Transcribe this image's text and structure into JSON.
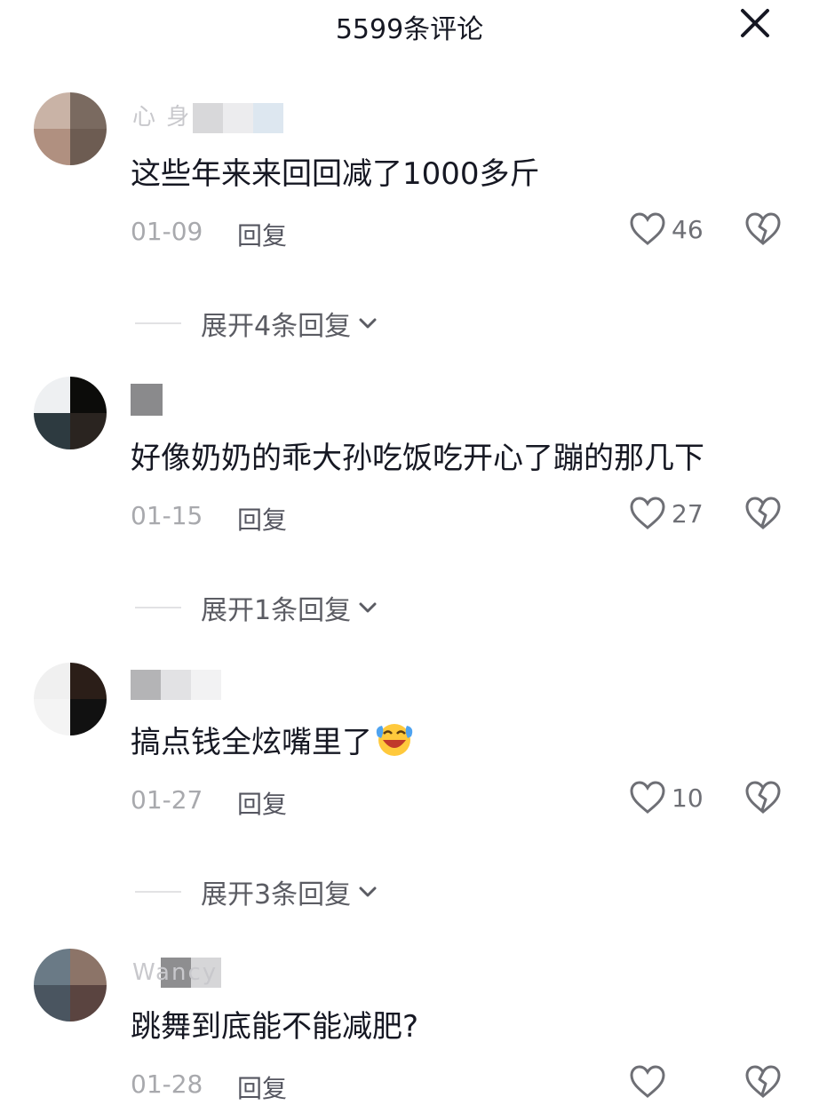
{
  "header": {
    "title": "5599条评论"
  },
  "comments": [
    {
      "username_hint": "心 身 ",
      "text": "这些年来来回回减了1000多斤",
      "date": "01-09",
      "reply_label": "回复",
      "likes": "46",
      "expand_label": "展开4条回复"
    },
    {
      "username_hint": "",
      "text": "好像奶奶的乖大孙吃饭吃开心了蹦的那几下",
      "date": "01-15",
      "reply_label": "回复",
      "likes": "27",
      "expand_label": "展开1条回复"
    },
    {
      "username_hint": "",
      "text": "搞点钱全炫嘴里了",
      "emoji": "laughing-crying-emoji",
      "date": "01-27",
      "reply_label": "回复",
      "likes": "10",
      "expand_label": "展开3条回复"
    },
    {
      "username_hint": "Wancy",
      "text": "跳舞到底能不能减肥?",
      "date": "01-28",
      "reply_label": "回复",
      "likes": "",
      "expand_label": ""
    }
  ],
  "icons": {
    "close": "close-icon",
    "like": "heart-outline-icon",
    "dislike": "broken-heart-icon",
    "expand": "chevron-down-icon"
  },
  "colors": {
    "text_primary": "#161823",
    "text_secondary": "#a8a9ad",
    "reply": "#555660"
  }
}
